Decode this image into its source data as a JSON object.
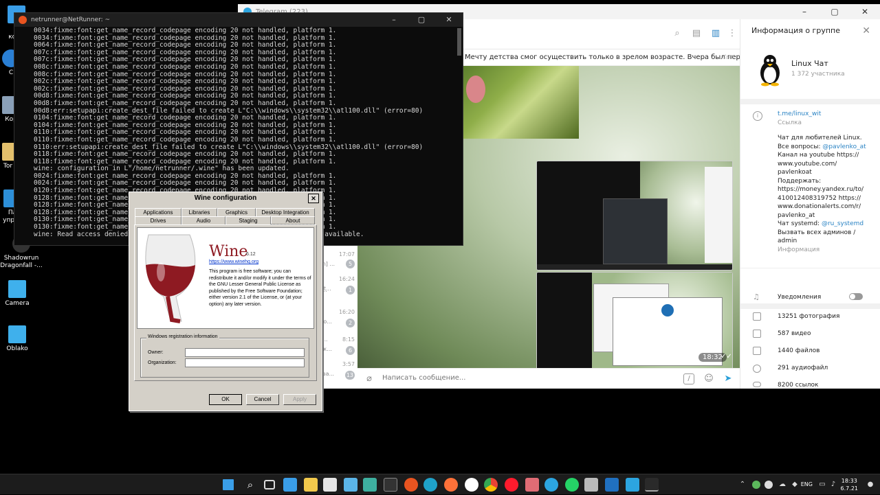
{
  "desktop": {
    "icons": [
      {
        "label": "Э"
      },
      {
        "label": "комп"
      },
      {
        "label": "С"
      },
      {
        "label": "Кор"
      },
      {
        "label": "Tor B"
      },
      {
        "label": "Па"
      },
      {
        "label": "управ"
      },
      {
        "label": "Shadowrun"
      },
      {
        "label": "Dragonfall -..."
      },
      {
        "label": "Camera"
      },
      {
        "label": "Oblako"
      }
    ]
  },
  "terminal": {
    "title": "netrunner@NetRunner: ~",
    "lines": [
      "0034:fixme:font:get_name_record_codepage encoding 20 not handled, platform 1.",
      "0034:fixme:font:get_name_record_codepage encoding 20 not handled, platform 1.",
      "0064:fixme:font:get_name_record_codepage encoding 20 not handled, platform 1.",
      "007c:fixme:font:get_name_record_codepage encoding 20 not handled, platform 1.",
      "007c:fixme:font:get_name_record_codepage encoding 20 not handled, platform 1.",
      "008c:fixme:font:get_name_record_codepage encoding 20 not handled, platform 1.",
      "008c:fixme:font:get_name_record_codepage encoding 20 not handled, platform 1.",
      "002c:fixme:font:get_name_record_codepage encoding 20 not handled, platform 1.",
      "002c:fixme:font:get_name_record_codepage encoding 20 not handled, platform 1.",
      "00d8:fixme:font:get_name_record_codepage encoding 20 not handled, platform 1.",
      "00d8:fixme:font:get_name_record_codepage encoding 20 not handled, platform 1.",
      "00d8:err:setupapi:create_dest_file failed to create L\"C:\\\\windows\\\\system32\\\\atl100.dll\" (error=80)",
      "0104:fixme:font:get_name_record_codepage encoding 20 not handled, platform 1.",
      "0104:fixme:font:get_name_record_codepage encoding 20 not handled, platform 1.",
      "0110:fixme:font:get_name_record_codepage encoding 20 not handled, platform 1.",
      "0110:fixme:font:get_name_record_codepage encoding 20 not handled, platform 1.",
      "0110:err:setupapi:create_dest_file failed to create L\"C:\\\\windows\\\\system32\\\\atl100.dll\" (error=80)",
      "0118:fixme:font:get_name_record_codepage encoding 20 not handled, platform 1.",
      "0118:fixme:font:get_name_record_codepage encoding 20 not handled, platform 1.",
      "wine: configuration in L\"/home/netrunner/.wine\" has been updated.",
      "0024:fixme:font:get_name_record_codepage encoding 20 not handled, platform 1.",
      "0024:fixme:font:get_name_record_codepage encoding 20 not handled, platform 1.",
      "0120:fixme:font:get_name_record_codepage encoding 20 not handled, platform 1.",
      "0128:fixme:font:get_name_record_codepage encoding 20 not handled, platform 1.",
      "0128:fixme:font:get_name_record_codepage encoding 20 not handled, platform 1.",
      "0128:fixme:font:get_name_record_codepage encoding 20 not handled, platform 1.",
      "0130:fixme:font:get_name_record_codepage encoding 20 not handled, platform 1.",
      "0130:fixme:font:get_name_record_codepage encoding 20 not handled, platform 1.",
      "wine: Read access denied for de                                         t available."
    ]
  },
  "telegram": {
    "window_title": "Telegram (223)",
    "pinned_message": "Мечту детства смог осуществить только в зрелом возрасте. Вчера был первый урок...",
    "chat_list": [
      {
        "time": "17:07",
        "preview": "man] ...",
        "badge": "5"
      },
      {
        "time": "16:24",
        "preview": "к, et...",
        "badge": ""
      },
      {
        "time": "",
        "preview": "к ч...",
        "badge": "1"
      },
      {
        "time": "16:20",
        "preview": "",
        "badge": ""
      },
      {
        "time": "",
        "preview": "ксло...",
        "badge": "2"
      },
      {
        "time": "8:15",
        "preview": "J —...",
        "badge": ""
      },
      {
        "time": "",
        "preview": "ОС к...",
        "badge": "6"
      },
      {
        "time": "3:57",
        "preview": "",
        "badge": ""
      },
      {
        "time": "",
        "preview": "ли ва...",
        "badge": "13"
      }
    ],
    "message_time": "18:32",
    "compose_placeholder": "Написать сообщение...",
    "info": {
      "header": "Информация о группе",
      "group_name": "Linux Чат",
      "members": "1 372 участника",
      "link": "t.me/linux_wit",
      "link_caption": "Ссылка",
      "description_lines": [
        {
          "text": "Чат для любителей Linux.",
          "link": false
        },
        {
          "text": "Все вопросы: ",
          "link": false,
          "suffix": "@pavlenko_at"
        },
        {
          "text": "Канал на youtube https://",
          "link": false
        },
        {
          "text": "www.youtube.com/",
          "link": false
        },
        {
          "text": "pavlenkoat",
          "link": false
        },
        {
          "text": "Поддержать:",
          "link": false
        },
        {
          "text": "https://money.yandex.ru/to/",
          "link": false
        },
        {
          "text": "410012408319752 https://",
          "link": false
        },
        {
          "text": "www.donationalerts.com/r/",
          "link": false
        },
        {
          "text": "pavlenko_at",
          "link": false
        },
        {
          "text": "Чат systemd: ",
          "link": false,
          "suffix": "@ru_systemd"
        },
        {
          "text": "Вызвать всех админов /",
          "link": false
        },
        {
          "text": "admin",
          "link": false
        }
      ],
      "description_caption": "Информация",
      "notifications": "Уведомления",
      "media": [
        {
          "label": "13251 фотография",
          "icon": "photo-icon"
        },
        {
          "label": "587 видео",
          "icon": "video-icon"
        },
        {
          "label": "1440 файлов",
          "icon": "file-icon"
        },
        {
          "label": "291 аудиофайл",
          "icon": "audio-icon"
        },
        {
          "label": "8200 ссылок",
          "icon": "link-icon"
        }
      ]
    }
  },
  "wine": {
    "title": "Wine configuration",
    "tabs_row1": [
      "Applications",
      "Libraries",
      "Graphics",
      "Desktop Integration"
    ],
    "tabs_row2": [
      "Drives",
      "Audio",
      "Staging",
      "About"
    ],
    "app_name": "Wine",
    "version": "6.12",
    "url": "https://www.winehq.org",
    "license": "This program is free software; you can redistribute it and/or modify it under the terms of the GNU Lesser General Public License as published by the Free Software Foundation; either version 2.1 of the License, or (at your option) any later version.",
    "reg_title": "Windows registration information",
    "owner_label": "Owner:",
    "org_label": "Organization:",
    "owner_value": "",
    "org_value": "",
    "ok": "OK",
    "cancel": "Cancel",
    "apply": "Apply"
  },
  "taskbar": {
    "lang": "ENG",
    "time": "18:33",
    "date": "6.7.21",
    "colors": {
      "bg": "#1c1c1c",
      "start": "#3a9ee8"
    }
  }
}
